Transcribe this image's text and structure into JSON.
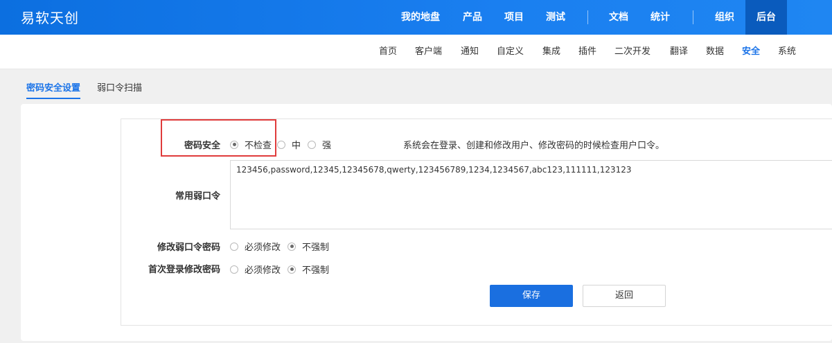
{
  "brand": "易软天创",
  "top_nav": {
    "items": [
      "我的地盘",
      "产品",
      "项目",
      "测试",
      "文档",
      "统计",
      "组织",
      "后台"
    ],
    "active": "后台"
  },
  "sub_nav": {
    "items": [
      "首页",
      "客户端",
      "通知",
      "自定义",
      "集成",
      "插件",
      "二次开发",
      "翻译",
      "数据",
      "安全",
      "系统"
    ],
    "active": "安全"
  },
  "tabs": {
    "items": [
      "密码安全设置",
      "弱口令扫描"
    ],
    "active": "密码安全设置"
  },
  "form": {
    "password_security": {
      "label": "密码安全",
      "options": [
        "不检查",
        "中",
        "强"
      ],
      "selected": "不检查",
      "hint": "系统会在登录、创建和修改用户、修改密码的时候检查用户口令。"
    },
    "weak_passwords": {
      "label": "常用弱口令",
      "value": "123456,password,12345,12345678,qwerty,123456789,1234,1234567,abc123,111111,123123"
    },
    "modify_weak_password": {
      "label": "修改弱口令密码",
      "options": [
        "必须修改",
        "不强制"
      ],
      "selected": "不强制"
    },
    "first_login_modify": {
      "label": "首次登录修改密码",
      "options": [
        "必须修改",
        "不强制"
      ],
      "selected": "不强制"
    },
    "save_label": "保存",
    "back_label": "返回"
  },
  "colors": {
    "topbar": "#1a7ff0",
    "accent": "#1a73e8",
    "highlight_box": "#e03b3b"
  }
}
